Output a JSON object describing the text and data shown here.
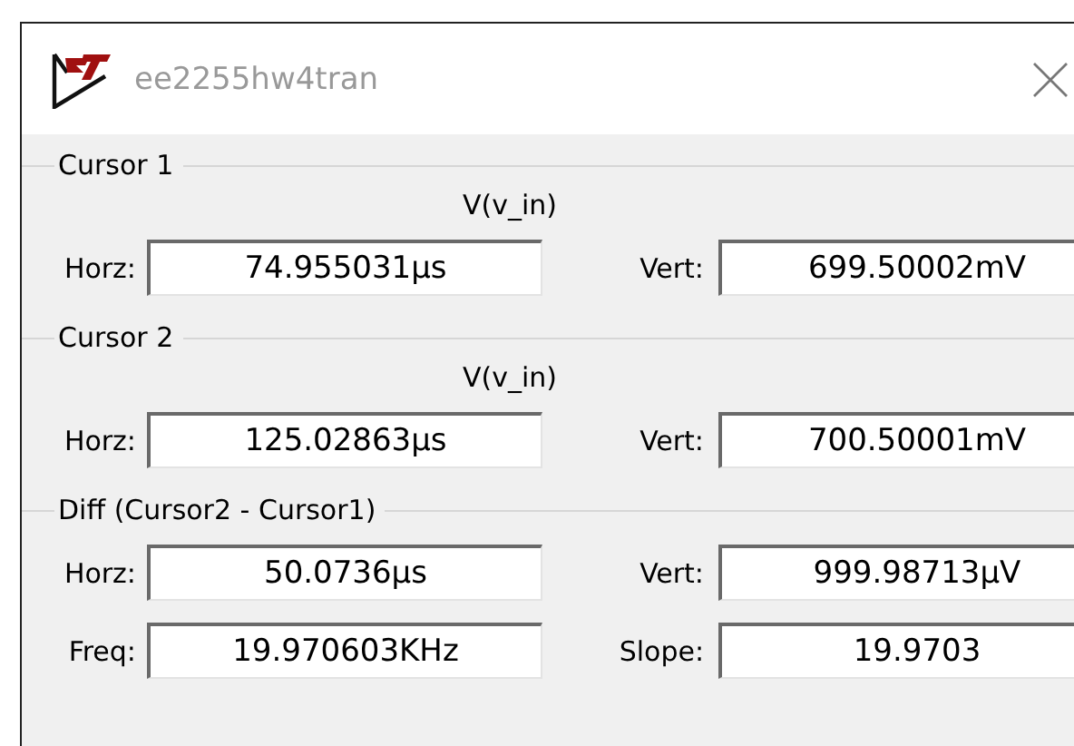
{
  "window": {
    "title": "ee2255hw4tran"
  },
  "groups": [
    {
      "title": "Cursor 1",
      "signal": "V(v_in)",
      "rows": [
        [
          {
            "label": "Horz:",
            "value": "74.955031µs"
          },
          {
            "label": "Vert:",
            "value": "699.50002mV"
          }
        ]
      ]
    },
    {
      "title": "Cursor 2",
      "signal": "V(v_in)",
      "rows": [
        [
          {
            "label": "Horz:",
            "value": "125.02863µs"
          },
          {
            "label": "Vert:",
            "value": "700.50001mV"
          }
        ]
      ]
    },
    {
      "title": "Diff (Cursor2 - Cursor1)",
      "rows": [
        [
          {
            "label": "Horz:",
            "value": "50.0736µs"
          },
          {
            "label": "Vert:",
            "value": "999.98713µV"
          }
        ],
        [
          {
            "label": "Freq:",
            "value": "19.970603KHz"
          },
          {
            "label": "Slope:",
            "value": "19.9703"
          }
        ]
      ]
    }
  ]
}
